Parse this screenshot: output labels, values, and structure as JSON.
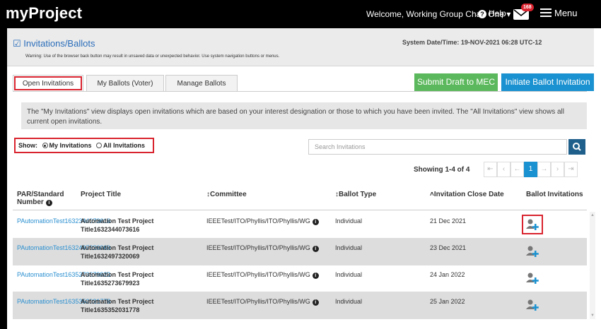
{
  "app": {
    "name": "myProject"
  },
  "topbar": {
    "welcome": "Welcome, Working Group Chair One",
    "help": "Help",
    "notifications": "168",
    "menu": "Menu"
  },
  "page": {
    "title": "Invitations/Ballots",
    "warning": "Warning: Use of the browser back button may result in unsaved data or unexpected behavior. Use system navigation buttons or menus.",
    "system_time": "System Date/Time: 19-NOV-2021  06:28 UTC-12"
  },
  "tabs": [
    "Open Invitations",
    "My Ballots (Voter)",
    "Manage Ballots"
  ],
  "actions": {
    "submit": "Submit Draft to MEC",
    "initiate": "Initiate Ballot Invitation"
  },
  "info_text": "The \"My Invitations\" view displays open invitations which are based on your interest designation or those to which you have been invited. The \"All Invitations\" view shows all current open invitations.",
  "filter": {
    "label": "Show:",
    "options": [
      "My Invitations",
      "All Invitations"
    ],
    "selected": "My Invitations"
  },
  "search": {
    "placeholder": "Search Invitations"
  },
  "pagination": {
    "showing": "Showing 1-4 of 4",
    "current_page": "1"
  },
  "columns": [
    "PAR/Standard Number",
    "Project Title",
    "↕Committee",
    "↕Ballot Type",
    "˄Invitation Close Date",
    "Ballot Invitations"
  ],
  "rows": [
    {
      "par": "PAutomationTest1632344073616",
      "title": "Automation Test Project Title1632344073616",
      "committee": "IEEETest/ITO/Phyllis/ITO/Phyllis/WG",
      "ballot_type": "Individual",
      "close_date": "21 Dec 2021"
    },
    {
      "par": "PAutomationTest1632497320069",
      "title": "Automation Test Project Title1632497320069",
      "committee": "IEEETest/ITO/Phyllis/ITO/Phyllis/WG",
      "ballot_type": "Individual",
      "close_date": "23 Dec 2021"
    },
    {
      "par": "PAutomationTest1635273679923",
      "title": "Automation Test Project Title1635273679923",
      "committee": "IEEETest/ITO/Phyllis/ITO/Phyllis/WG",
      "ballot_type": "Individual",
      "close_date": "24 Jan 2022"
    },
    {
      "par": "PAutomationTest1635352031778",
      "title": "Automation Test Project Title1635352031778",
      "committee": "IEEETest/ITO/Phyllis/ITO/Phyllis/WG",
      "ballot_type": "Individual",
      "close_date": "25 Jan 2022"
    }
  ],
  "colors": {
    "accent": "#1a91d0",
    "green": "#5cb85c",
    "highlight": "#d9232e",
    "link": "#2a8fd0"
  }
}
